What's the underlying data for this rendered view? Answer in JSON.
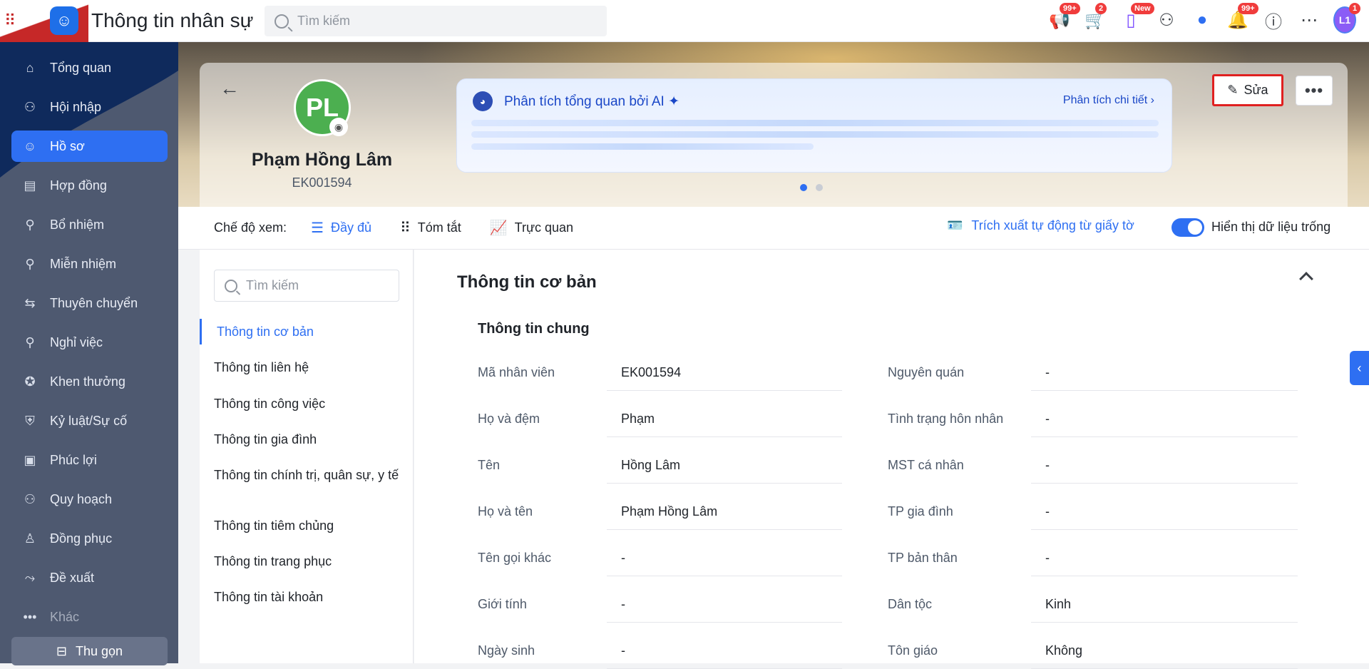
{
  "app": {
    "title": "Thông tin nhân sự",
    "search_placeholder": "Tìm kiếm"
  },
  "top_icons": [
    {
      "name": "megaphone-icon",
      "badge": "99+"
    },
    {
      "name": "cart-icon",
      "badge": "2"
    },
    {
      "name": "phone-icon",
      "badge": "New"
    },
    {
      "name": "add-user-icon",
      "badge": ""
    },
    {
      "name": "chat-icon",
      "badge": ""
    },
    {
      "name": "bell-icon",
      "badge": "99+"
    },
    {
      "name": "help-icon",
      "badge": ""
    },
    {
      "name": "more-icon",
      "badge": ""
    }
  ],
  "user": {
    "initials": "L1",
    "badge": "1"
  },
  "sidebar": {
    "items": [
      {
        "label": "Tổng quan",
        "icon": "home-icon"
      },
      {
        "label": "Hội nhập",
        "icon": "team-icon"
      },
      {
        "label": "Hồ sơ",
        "icon": "user-icon",
        "active": true
      },
      {
        "label": "Hợp đồng",
        "icon": "document-icon"
      },
      {
        "label": "Bổ nhiệm",
        "icon": "user-plus-icon"
      },
      {
        "label": "Miễn nhiệm",
        "icon": "user-minus-icon"
      },
      {
        "label": "Thuyên chuyển",
        "icon": "transfer-icon"
      },
      {
        "label": "Nghỉ việc",
        "icon": "user-x-icon"
      },
      {
        "label": "Khen thưởng",
        "icon": "award-icon"
      },
      {
        "label": "Kỷ luật/Sự cố",
        "icon": "shield-icon"
      },
      {
        "label": "Phúc lợi",
        "icon": "benefit-icon"
      },
      {
        "label": "Quy hoạch",
        "icon": "plan-icon"
      },
      {
        "label": "Đồng phục",
        "icon": "shirt-icon"
      },
      {
        "label": "Đề xuất",
        "icon": "proposal-icon"
      },
      {
        "label": "Khác",
        "icon": "ellipsis-icon"
      }
    ],
    "collapse_label": "Thu gọn"
  },
  "profile": {
    "initials": "PL",
    "name": "Phạm Hồng Lâm",
    "code": "EK001594"
  },
  "ai": {
    "title": "Phân tích tổng quan bởi AI",
    "detail_label": "Phân tích chi tiết"
  },
  "actions": {
    "edit_label": "Sửa"
  },
  "view": {
    "label": "Chế độ xem:",
    "options": [
      "Đầy đủ",
      "Tóm tắt",
      "Trực quan"
    ],
    "extract_label": "Trích xuất tự động từ giấy tờ",
    "toggle_label": "Hiển thị dữ liệu trống"
  },
  "leftnav": {
    "search_placeholder": "Tìm kiếm",
    "items": [
      "Thông tin cơ bản",
      "Thông tin liên hệ",
      "Thông tin công việc",
      "Thông tin gia đình",
      "Thông tin chính trị, quân sự, y tế",
      "Thông tin tiêm chủng",
      "Thông tin trang phục",
      "Thông tin tài khoản"
    ]
  },
  "main": {
    "section_title": "Thông tin cơ bản",
    "subsection_title": "Thông tin chung",
    "left_fields": [
      {
        "label": "Mã nhân viên",
        "value": "EK001594"
      },
      {
        "label": "Họ và đệm",
        "value": "Phạm"
      },
      {
        "label": "Tên",
        "value": "Hồng Lâm"
      },
      {
        "label": "Họ và tên",
        "value": "Phạm Hồng Lâm"
      },
      {
        "label": "Tên gọi khác",
        "value": "-"
      },
      {
        "label": "Giới tính",
        "value": "-"
      },
      {
        "label": "Ngày sinh",
        "value": "-"
      }
    ],
    "right_fields": [
      {
        "label": "Nguyên quán",
        "value": "-"
      },
      {
        "label": "Tình trạng hôn nhân",
        "value": "-"
      },
      {
        "label": "MST cá nhân",
        "value": "-"
      },
      {
        "label": "TP gia đình",
        "value": "-"
      },
      {
        "label": "TP bản thân",
        "value": "-"
      },
      {
        "label": "Dân tộc",
        "value": "Kinh"
      },
      {
        "label": "Tôn giáo",
        "value": "Không"
      }
    ]
  }
}
